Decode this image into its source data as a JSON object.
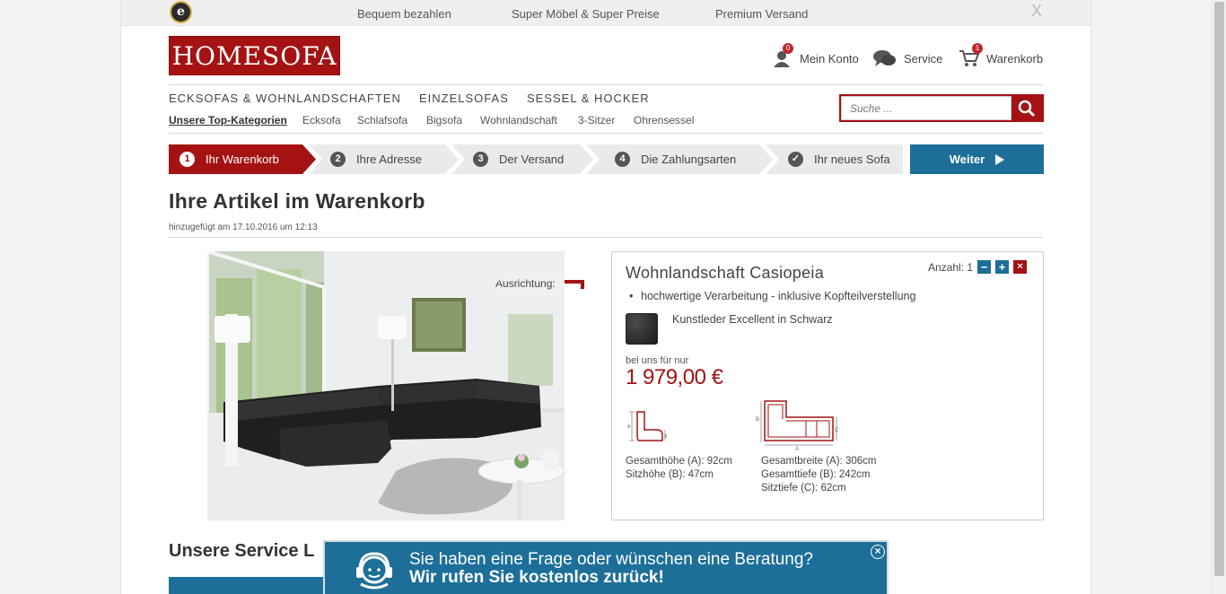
{
  "topbar": {
    "trust_letter": "e",
    "items": [
      "Bequem bezahlen",
      "Super Möbel & Super Preise",
      "Premium Versand"
    ],
    "close": "X"
  },
  "header": {
    "logo": "HOMESOFA",
    "account_label": "Mein Konto",
    "account_badge": "0",
    "service_label": "Service",
    "cart_label": "Warenkorb",
    "cart_badge": "1"
  },
  "nav": {
    "main": [
      "ECKSOFAS & WOHNLANDSCHAFTEN",
      "EINZELSOFAS",
      "SESSEL & HOCKER"
    ],
    "sub": [
      "Unsere Top-Kategorien",
      "Ecksofa",
      "Schlafsofa",
      "Bigsofa",
      "Wohnlandschaft",
      "3-Sitzer",
      "Ohrensessel"
    ]
  },
  "search": {
    "placeholder": "Suche ..."
  },
  "steps": [
    {
      "num": "1",
      "label": "Ihr Warenkorb"
    },
    {
      "num": "2",
      "label": "Ihre Adresse"
    },
    {
      "num": "3",
      "label": "Der Versand"
    },
    {
      "num": "4",
      "label": "Die Zahlungsarten"
    },
    {
      "num": "✓",
      "label": "Ihr neues Sofa"
    }
  ],
  "weiter_label": "Weiter",
  "page": {
    "title": "Ihre Artikel im Warenkorb",
    "subtitle": "hinzugefügt am 17.10.2016 um 12:13"
  },
  "orientation_label": "Ausrichtung:",
  "product": {
    "name": "Wohnlandschaft Casiopeia",
    "quantity_label": "Anzahl: 1",
    "feature": "hochwertige Verarbeitung - inklusive Kopfteilverstellung",
    "material": "Kunstleder Excellent in Schwarz",
    "price_label": "bei uns für nur",
    "price": "1 979,00 €",
    "dims_left": [
      "Gesamthöhe (A): 92cm",
      "Sitzhöhe (B): 47cm"
    ],
    "dims_right": [
      "Gesamtbreite (A): 306cm",
      "Gesamttiefe (B): 242cm",
      "Sitztiefe (C): 62cm"
    ]
  },
  "service_heading": "Unsere Service L",
  "chat": {
    "line1": "Sie haben eine Frage oder wünschen eine Beratung?",
    "line2": "Wir rufen Sie kostenlos zurück!",
    "close": "×"
  },
  "colors": {
    "brand_red": "#a41214",
    "accent_blue": "#1d6f99"
  }
}
